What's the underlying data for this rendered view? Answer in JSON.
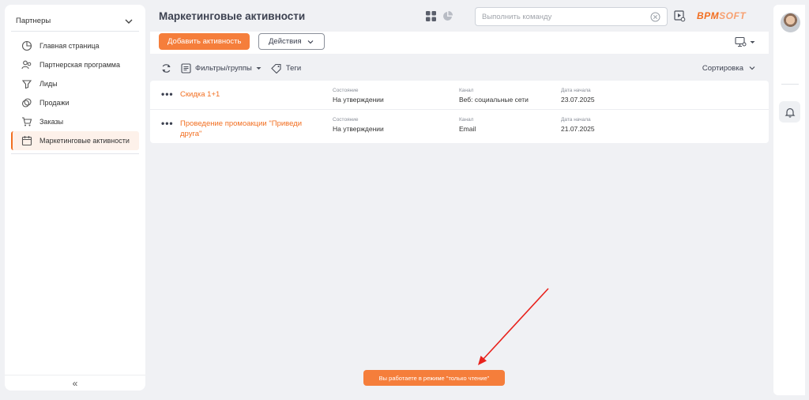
{
  "sidebar": {
    "section_title": "Партнеры",
    "items": [
      {
        "label": "Главная страница",
        "icon": "pie-chart-icon"
      },
      {
        "label": "Партнерская программа",
        "icon": "handshake-icon"
      },
      {
        "label": "Лиды",
        "icon": "funnel-icon"
      },
      {
        "label": "Продажи",
        "icon": "coins-icon"
      },
      {
        "label": "Заказы",
        "icon": "cart-icon"
      },
      {
        "label": "Маркетинговые активности",
        "icon": "calendar-icon",
        "active": true
      }
    ],
    "collapse_glyph": "«"
  },
  "header": {
    "title": "Маркетинговые активности",
    "command_placeholder": "Выполнить команду",
    "logo_primary": "BPM",
    "logo_secondary": "SOFT"
  },
  "actions": {
    "add_label": "Добавить активность",
    "actions_label": "Действия"
  },
  "filters": {
    "filters_groups_label": "Фильтры/группы",
    "tags_label": "Теги",
    "sort_label": "Сортировка"
  },
  "list": {
    "rows": [
      {
        "name": "Скидка 1+1",
        "state_label": "Состояние",
        "state": "На утверждении",
        "channel_label": "Канал",
        "channel": "Веб: социальные сети",
        "date_label": "Дата начала",
        "date": "23.07.2025"
      },
      {
        "name": "Проведение промоакции \"Приведи друга\"",
        "state_label": "Состояние",
        "state": "На утверждении",
        "channel_label": "Канал",
        "channel": "Email",
        "date_label": "Дата начала",
        "date": "21.07.2025"
      }
    ],
    "row_menu_glyph": "•••"
  },
  "toast": {
    "message": "Вы работаете в режиме \"только чтение\""
  },
  "colors": {
    "accent": "#f26f21",
    "accent_button": "#f57e3b",
    "annotation_arrow": "#e8221c"
  }
}
